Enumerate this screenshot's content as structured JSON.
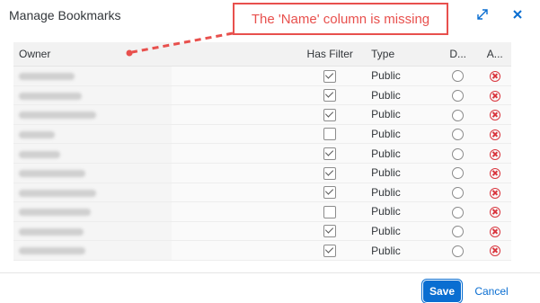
{
  "dialog": {
    "title": "Manage Bookmarks",
    "resize_icon": "expand-arrows-icon",
    "close_icon": "close-icon"
  },
  "annotation": {
    "text": "The 'Name' column is missing",
    "color": "#e8504d"
  },
  "table": {
    "columns": {
      "owner": "Owner",
      "has_filter": "Has Filter",
      "type": "Type",
      "default": "D...",
      "actions": "A..."
    },
    "rows": [
      {
        "has_filter": true,
        "type": "Public"
      },
      {
        "has_filter": true,
        "type": "Public"
      },
      {
        "has_filter": true,
        "type": "Public"
      },
      {
        "has_filter": false,
        "type": "Public"
      },
      {
        "has_filter": true,
        "type": "Public"
      },
      {
        "has_filter": true,
        "type": "Public"
      },
      {
        "has_filter": true,
        "type": "Public"
      },
      {
        "has_filter": false,
        "type": "Public"
      },
      {
        "has_filter": true,
        "type": "Public"
      },
      {
        "has_filter": true,
        "type": "Public"
      }
    ]
  },
  "footer": {
    "save_label": "Save",
    "cancel_label": "Cancel"
  },
  "colors": {
    "accent": "#0a6ed1",
    "delete": "#d9363e"
  }
}
